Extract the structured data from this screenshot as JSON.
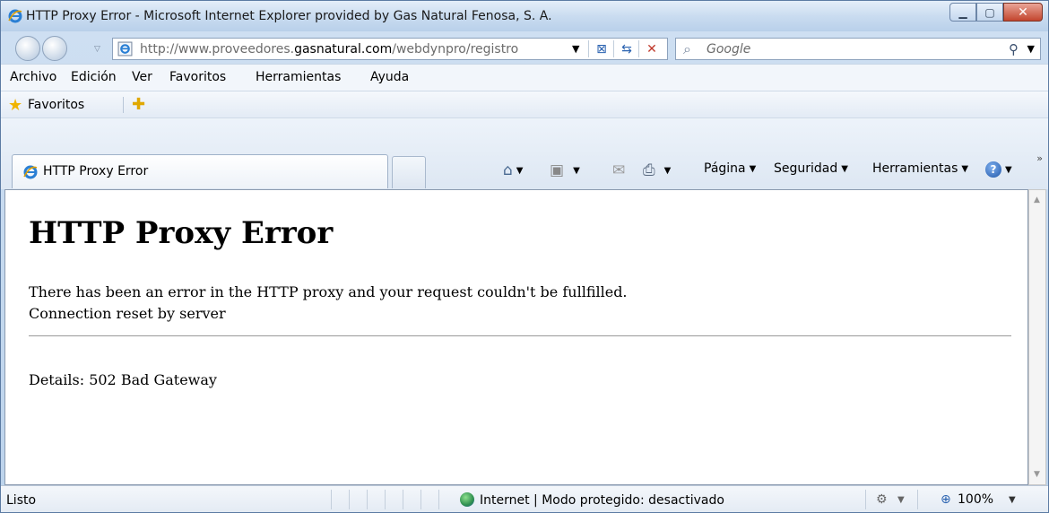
{
  "window": {
    "title": "HTTP Proxy Error - Microsoft Internet Explorer provided by Gas Natural Fenosa, S. A."
  },
  "address_bar": {
    "url_prefix": "http://www.proveedores.",
    "url_domain": "gasnatural.com",
    "url_suffix": "/webdynpro/registro"
  },
  "search": {
    "placeholder": "Google"
  },
  "menu": {
    "items": [
      "Archivo",
      "Edición",
      "Ver",
      "Favoritos",
      "Herramientas",
      "Ayuda"
    ]
  },
  "favorites": {
    "label": "Favoritos"
  },
  "tab": {
    "label": "HTTP Proxy Error"
  },
  "command_bar": {
    "page": "Página",
    "safety": "Seguridad",
    "tools": "Herramientas"
  },
  "page": {
    "heading": "HTTP Proxy Error",
    "message": "There has been an error in the HTTP proxy and your request couldn't be fullfilled.",
    "reason": "Connection reset by server",
    "details": "Details: 502 Bad Gateway"
  },
  "status": {
    "text": "Listo",
    "zone": "Internet | Modo protegido: desactivado",
    "zoom": "100%"
  },
  "colors": {
    "frame": "#bcd3ec",
    "close_button": "#c3452e",
    "content_bg": "#ffffff"
  }
}
